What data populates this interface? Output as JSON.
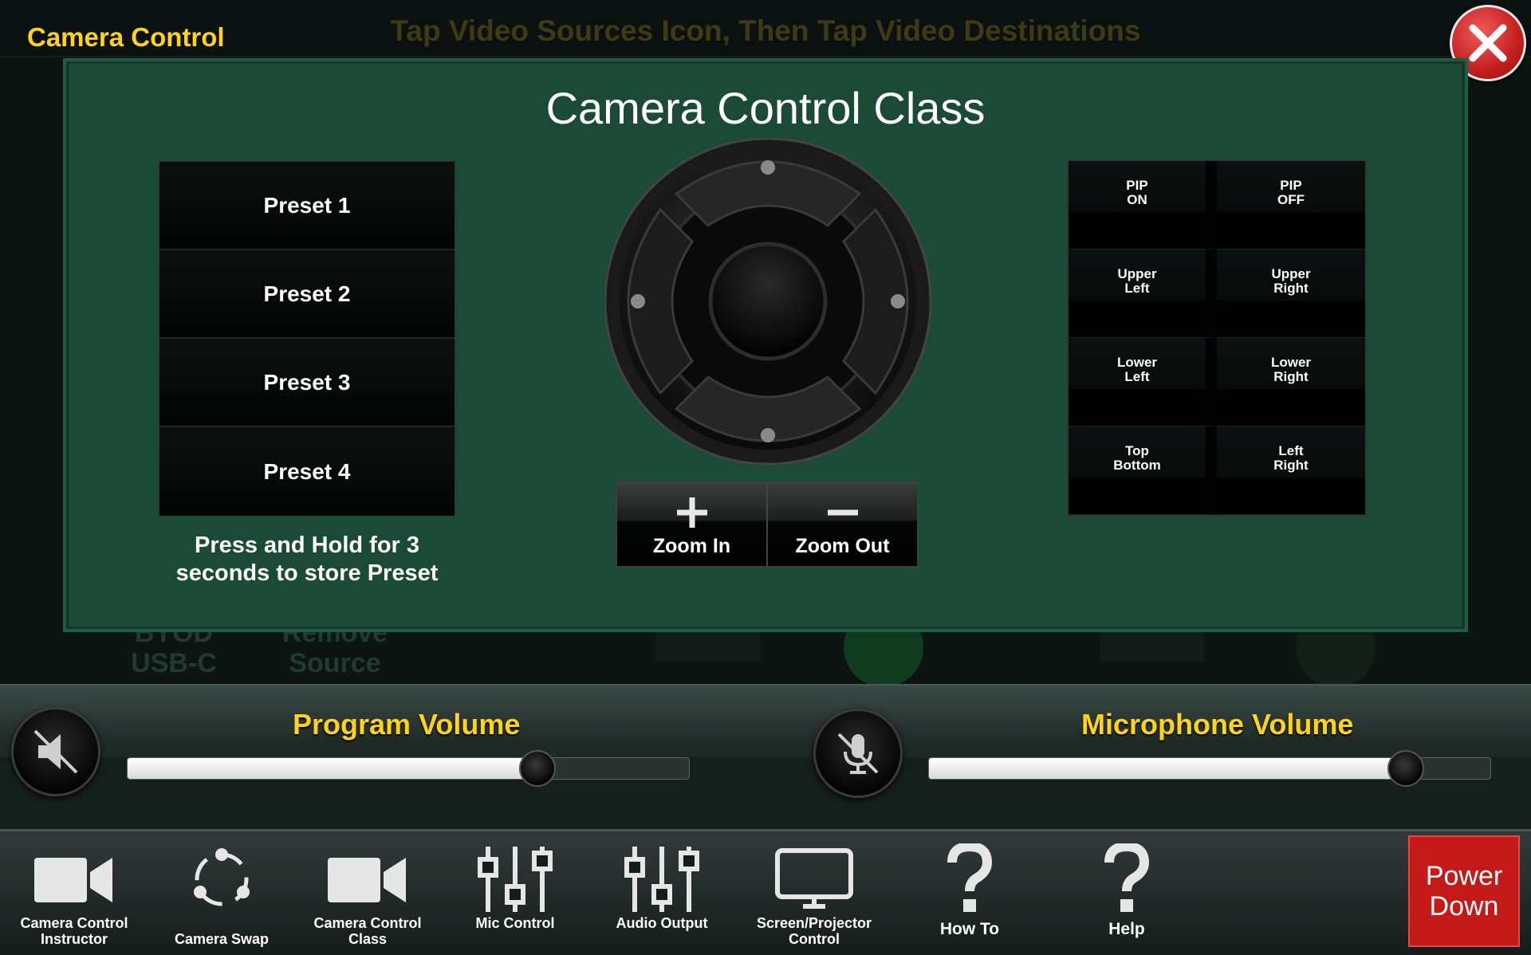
{
  "header": {
    "modal_title": "Camera Control",
    "background_instruction": "Tap Video Sources Icon, Then Tap Video Destinations"
  },
  "background": {
    "sources": [
      "BYOD\nUSB-C",
      "Remove\nSource"
    ]
  },
  "modal": {
    "heading": "Camera Control Class",
    "presets": [
      "Preset 1",
      "Preset 2",
      "Preset 3",
      "Preset 4"
    ],
    "preset_hint": "Press and Hold for 3 seconds to store Preset",
    "zoom": {
      "in_label": "Zoom In",
      "out_label": "Zoom Out"
    },
    "pip": [
      "PIP\nON",
      "PIP\nOFF",
      "Upper\nLeft",
      "Upper\nRight",
      "Lower\nLeft",
      "Lower\nRight",
      "Top\nBottom",
      "Left\nRight"
    ]
  },
  "volume": {
    "program": {
      "label": "Program Volume",
      "level": 0.73
    },
    "microphone": {
      "label": "Microphone Volume",
      "level": 0.85
    }
  },
  "nav": {
    "items": [
      {
        "label": "Camera Control\nInstructor",
        "icon": "camera-icon"
      },
      {
        "label": "Camera Swap",
        "icon": "swap-icon"
      },
      {
        "label": "Camera Control\nClass",
        "icon": "camera-icon"
      },
      {
        "label": "Mic Control",
        "icon": "mixer-icon"
      },
      {
        "label": "Audio Output",
        "icon": "mixer-icon"
      },
      {
        "label": "Screen/Projector\nControl",
        "icon": "monitor-icon"
      },
      {
        "label": "How To",
        "icon": "question-icon"
      },
      {
        "label": "Help",
        "icon": "question-icon"
      }
    ],
    "power_label": "Power\nDown"
  },
  "colors": {
    "accent_yellow": "#ffd21c",
    "modal_green": "#1b4a36",
    "power_red": "#c41a1a"
  }
}
